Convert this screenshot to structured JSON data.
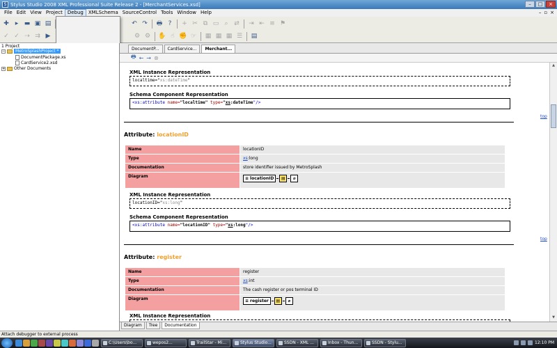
{
  "window": {
    "title": "Stylus Studio 2008 XML Professional Suite Release 2 - [MerchantServices.xsd]",
    "controls": {
      "minimize": "–",
      "maximize": "□",
      "close": "×"
    },
    "mdi_controls": [
      "–",
      "▫",
      "×"
    ]
  },
  "menubar": {
    "items": [
      "File",
      "Edit",
      "View",
      "Project",
      "Debug",
      "XMLSchema",
      "SourceControl",
      "Tools",
      "Window",
      "Help"
    ],
    "active": "Debug"
  },
  "project_pane": {
    "header": "1 Project",
    "items": [
      {
        "label": "MetroSplashProject *",
        "selected": true
      },
      {
        "label": "DocumentPackage.xs"
      },
      {
        "label": "CardService2.xsd"
      },
      {
        "label": "Other Documents"
      }
    ]
  },
  "doc_tabs": [
    "DocumentP...",
    "CardService...",
    "Merchant..."
  ],
  "doc_nav": [
    "🖶",
    "←",
    "→",
    "⊗"
  ],
  "content": {
    "top_section": {
      "xml_instance_label": "XML Instance Representation",
      "xml_instance_attr": "localtime=\"",
      "xml_instance_type": "xs:dateTime",
      "xml_instance_end": "\"",
      "schema_label": "Schema Component Representation",
      "schema_open": "<xs:attribute",
      "schema_name_attr": " name=",
      "schema_name_val": "\"localtime\"",
      "schema_type_attr": " type=",
      "schema_type_q": "\"",
      "schema_type_val": "xs",
      "schema_type_rest": ":dateTime",
      "schema_close": "\"/>"
    },
    "top_link": "top",
    "attr_heading": "Attribute: ",
    "attributes": [
      {
        "name": "locationID",
        "rows": {
          "name_key": "Name",
          "name_val": "locationID",
          "type_key": "Type",
          "type_ns": "xs",
          "type_rest": ":long",
          "doc_key": "Documentation",
          "doc_val": "store identifier issued by MetroSplash",
          "diagram_key": "Diagram"
        },
        "diagram_label": "locationID",
        "xml_instance_label": "XML Instance Representation",
        "xml_instance_attr": "locationID=\"",
        "xml_instance_type": "xs:long",
        "xml_instance_end": "\"",
        "schema_label": "Schema Component Representation",
        "schema_open": "<xs:attribute",
        "schema_name_attr": " name=",
        "schema_name_val": "\"locationID\"",
        "schema_type_attr": " type=",
        "schema_type_q": "\"",
        "schema_type_val": "xs",
        "schema_type_rest": ":long",
        "schema_close": "\"/>"
      },
      {
        "name": "register",
        "rows": {
          "name_key": "Name",
          "name_val": "register",
          "type_key": "Type",
          "type_ns": "xs",
          "type_rest": ":int",
          "doc_key": "Documentation",
          "doc_val": "The cash register or pos terminal ID",
          "diagram_key": "Diagram"
        },
        "diagram_label": "register",
        "xml_instance_label": "XML Instance Representation"
      }
    ]
  },
  "bottom_tabs": [
    "Diagram",
    "Tree",
    "Documentation"
  ],
  "bottom_tab_active": "Documentation",
  "status": "Attach debugger to external process",
  "taskbar": {
    "tasks": [
      "C:\\Users\\bo...",
      "wepos2...",
      "TrailStar - Mi...",
      "Stylus Studio...",
      "SSDN - XML ...",
      "Inbox - Thun...",
      "SSDN - Stylu..."
    ],
    "active_task": "Stylus Studio...",
    "clock": "12:10 PM"
  },
  "colors": {
    "table_key_bg": "#f4a0a0",
    "table_val_bg": "#e8e8e8",
    "attr_name": "#f0a030",
    "link": "#1a4ad0"
  }
}
